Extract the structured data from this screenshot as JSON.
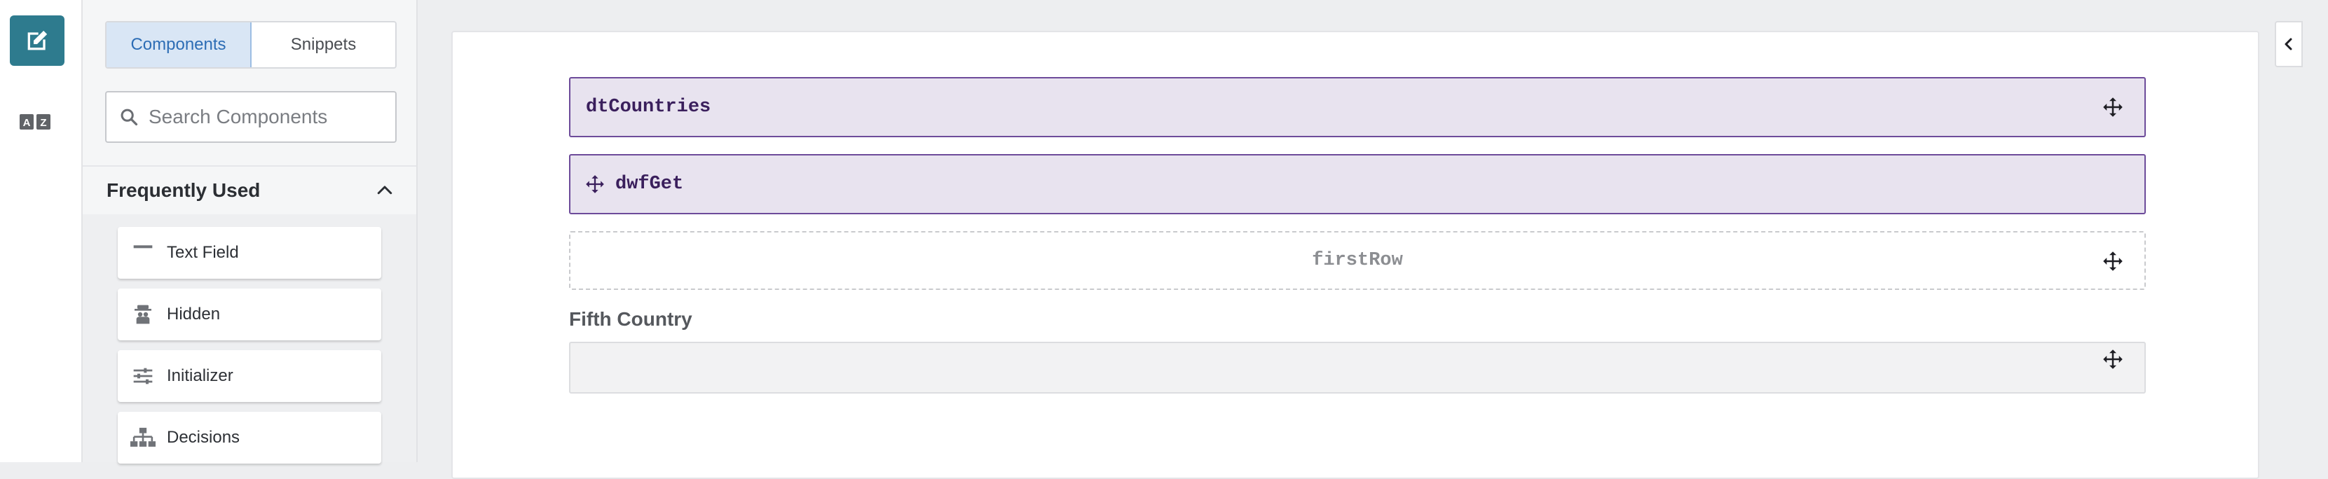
{
  "rail": {
    "edit_icon": "edit-icon",
    "translate_icon": "translate-icon"
  },
  "panel": {
    "tabs": [
      {
        "label": "Components",
        "active": true
      },
      {
        "label": "Snippets",
        "active": false
      }
    ],
    "search": {
      "placeholder": "Search Components",
      "value": ""
    },
    "frequently_used": {
      "title": "Frequently Used",
      "expanded": true,
      "items": [
        {
          "label": "Text Field",
          "icon": "text-field-icon"
        },
        {
          "label": "Hidden",
          "icon": "hidden-icon"
        },
        {
          "label": "Initializer",
          "icon": "initializer-icon"
        },
        {
          "label": "Decisions",
          "icon": "decisions-icon"
        }
      ]
    }
  },
  "canvas": {
    "blocks": [
      {
        "label": "dtCountries",
        "kind": "data-table"
      },
      {
        "label": "dwfGet",
        "kind": "data-workflow"
      },
      {
        "label": "firstRow",
        "kind": "row"
      }
    ],
    "field": {
      "label": "Fifth Country",
      "value": ""
    }
  },
  "colors": {
    "accent": "#2e7b8e",
    "block_border": "#6d4b9a",
    "block_fill": "#e8e3ef",
    "tab_active_fill": "#d9e6f5",
    "tab_active_text": "#2d6db5"
  }
}
